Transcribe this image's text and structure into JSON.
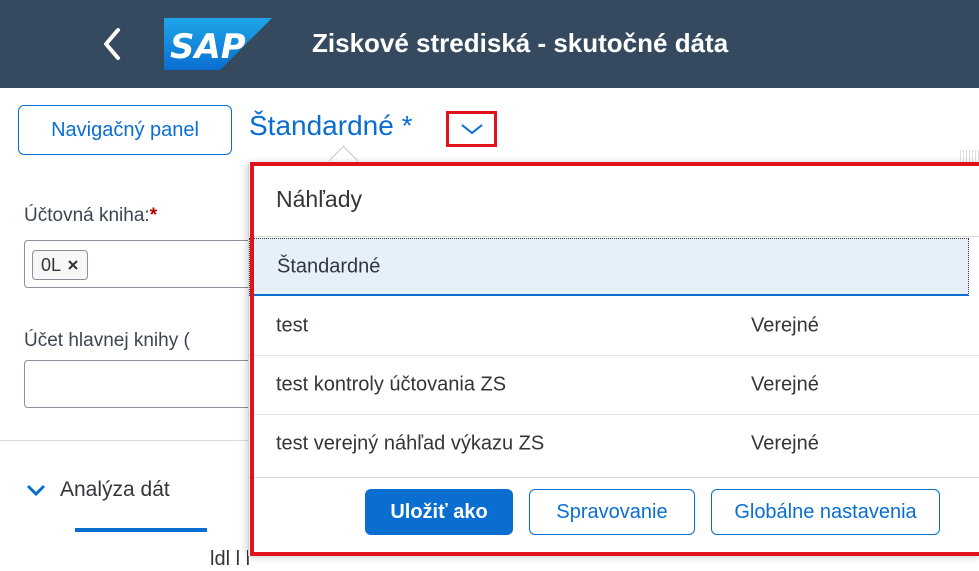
{
  "shell": {
    "back_icon": "chevron-left-icon",
    "logo_text": "SAP",
    "title": "Ziskové strediská - skutočné dáta",
    "bg_color": "#354a5f"
  },
  "variant": {
    "nav_panel_label": "Navigačný panel",
    "current": "Štandardné *",
    "toggle_icon": "chevron-down-icon",
    "highlight_color": "#e0121b"
  },
  "filters": {
    "ledger_label": "Účtovná kniha:",
    "ledger_required": "*",
    "ledger_token": "0L",
    "token_remove_icon": "close-icon",
    "gl_account_label": "Účet hlavnej knihy (",
    "gl_account_value": ""
  },
  "analysis": {
    "icon": "chevron-down-icon",
    "label": "Analýza dát",
    "bottom_text": "ldl  l l"
  },
  "popover": {
    "header": "Náhľady",
    "views": [
      {
        "name": "Štandardné",
        "scope": "",
        "selected": true
      },
      {
        "name": "test",
        "scope": "Verejné",
        "selected": false
      },
      {
        "name": "test kontroly účtovania ZS",
        "scope": "Verejné",
        "selected": false
      },
      {
        "name": "test verejný náhľad výkazu ZS",
        "scope": "Verejné",
        "selected": false
      }
    ],
    "buttons": {
      "save_as": "Uložiť ako",
      "manage": "Spravovanie",
      "global_settings": "Globálne nastavenia"
    },
    "accent": "#0a6ed1"
  }
}
